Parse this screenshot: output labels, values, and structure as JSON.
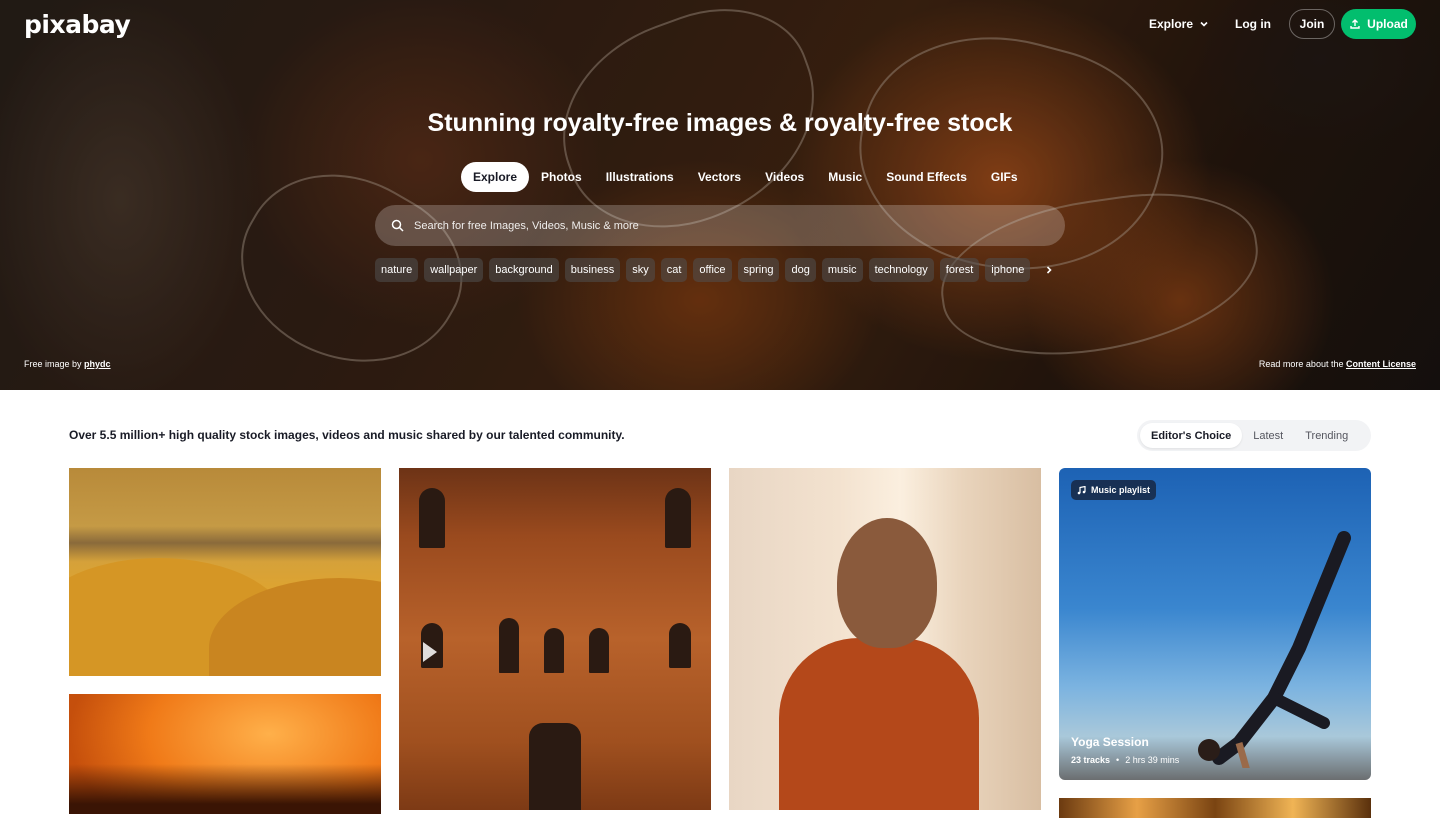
{
  "brand": {
    "logo": "pixabay",
    "accent": "#02be6e"
  },
  "topnav": {
    "explore": "Explore",
    "login": "Log in",
    "join": "Join",
    "upload": "Upload"
  },
  "hero": {
    "title": "Stunning royalty-free images & royalty-free stock",
    "tabs": [
      "Explore",
      "Photos",
      "Illustrations",
      "Vectors",
      "Videos",
      "Music",
      "Sound Effects",
      "GIFs"
    ],
    "active_tab": "Explore",
    "search_placeholder": "Search for free Images, Videos, Music & more",
    "tags": [
      "nature",
      "wallpaper",
      "background",
      "business",
      "sky",
      "cat",
      "office",
      "spring",
      "dog",
      "music",
      "technology",
      "forest",
      "iphone"
    ],
    "credit_prefix": "Free image by",
    "credit_author": "phydc",
    "license_prefix": "Read more about the",
    "license_link": "Content License"
  },
  "main": {
    "tagline": "Over 5.5 million+ high quality stock images, videos and music shared by our talented community.",
    "sort": [
      "Editor's Choice",
      "Latest",
      "Trending"
    ],
    "active_sort": "Editor's Choice",
    "playlist": {
      "badge": "Music playlist",
      "title": "Yoga Session",
      "tracks": "23 tracks",
      "duration": "2 hrs 39 mins"
    }
  }
}
